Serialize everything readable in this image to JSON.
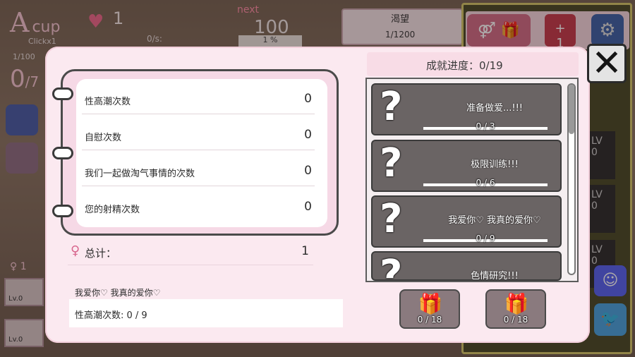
{
  "hud": {
    "cup_letter": "A",
    "cup_word": "cup",
    "click_label": "Clickx1",
    "heart_count": "1",
    "next_label": "next",
    "next_value": "100",
    "rate_label": "0/s:",
    "rate_percent": "1  %",
    "orgasm_fraction": "1/100",
    "orgasm_big": "0",
    "orgasm_total": "/7",
    "desire_label": "渴望",
    "desire_value": "1/1200",
    "plus_label": "+\n1",
    "left_counter": "1",
    "bottom_lv": [
      "Lv.0",
      "Lv.0"
    ],
    "lv_labels": [
      "LV\n0",
      "LV\n0",
      "LV\n0"
    ]
  },
  "stats": {
    "rows": [
      {
        "label": "性高潮次数",
        "value": "0"
      },
      {
        "label": "自慰次数",
        "value": "0"
      },
      {
        "label": "我们一起做淘气事情的次数",
        "value": "0"
      },
      {
        "label": "您的射精次数",
        "value": "0"
      }
    ],
    "total_label": "总计：",
    "total_value": "1"
  },
  "selected": {
    "name": "我爱你♡ 我真的爱你♡",
    "detail": "性高潮次数: 0 / 9"
  },
  "achievements": {
    "header": "成就进度：0/19",
    "items": [
      {
        "title": "准备做爱...!!!",
        "progress": "0 / 3"
      },
      {
        "title": "极限训练!!!",
        "progress": "0 / 6"
      },
      {
        "title": "我爱你♡ 我真的爱你♡",
        "progress": "0 / 9"
      },
      {
        "title": "色情研究!!!",
        "progress": ""
      }
    ],
    "rewards": [
      {
        "count": "0 / 18"
      },
      {
        "count": "0 / 18"
      }
    ]
  },
  "colors": {
    "modal_bg": "#fbe9f0",
    "accent_pink": "#f06f98",
    "card_gray": "#6a6464"
  }
}
